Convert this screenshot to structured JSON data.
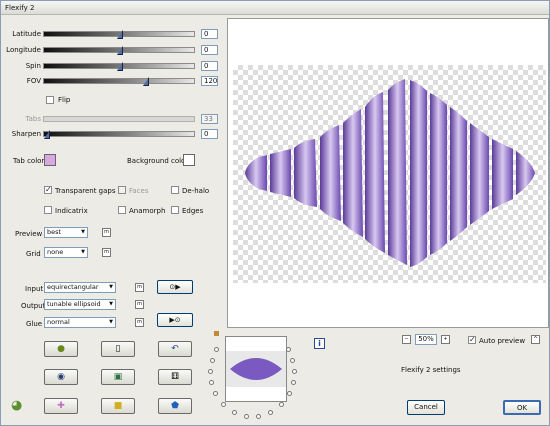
{
  "window": {
    "title": "Flexify 2"
  },
  "sliders": [
    {
      "label": "Latitude",
      "value": "0",
      "level": 0.5
    },
    {
      "label": "Longitude",
      "value": "0",
      "level": 0.5
    },
    {
      "label": "Spin",
      "value": "0",
      "level": 0.5
    },
    {
      "label": "FOV",
      "value": "120",
      "level": 0.67
    }
  ],
  "flip_label": "Flip",
  "tabs": {
    "label": "Tabs",
    "value": "33"
  },
  "sharpen": {
    "label": "Sharpen",
    "value": "0",
    "level": 0.0
  },
  "tab_color_label": "Tab color",
  "tab_color": "#d8a8e0",
  "background_color_label": "Background color",
  "background_color": "#ffffff",
  "options": {
    "transparent_gaps": "Transparent gaps",
    "faces": "Faces",
    "de_halo": "De-halo",
    "indicatrix": "Indicatrix",
    "anamorph": "Anamorph",
    "edges": "Edges"
  },
  "preview_mode": {
    "label": "Preview",
    "value": "best"
  },
  "grid": {
    "label": "Grid",
    "value": "none"
  },
  "input": {
    "label": "Input",
    "value": "equirectangular"
  },
  "output": {
    "label": "Output",
    "value": "tunable ellipsoid"
  },
  "glue": {
    "label": "Glue",
    "value": "normal"
  },
  "zoom": {
    "minus": "−",
    "value": "50%",
    "plus": "+"
  },
  "auto_preview": "Auto preview",
  "settings_label": "Flexify 2 settings",
  "cancel": "Cancel",
  "ok": "OK",
  "info": "i",
  "small_icon": "m"
}
